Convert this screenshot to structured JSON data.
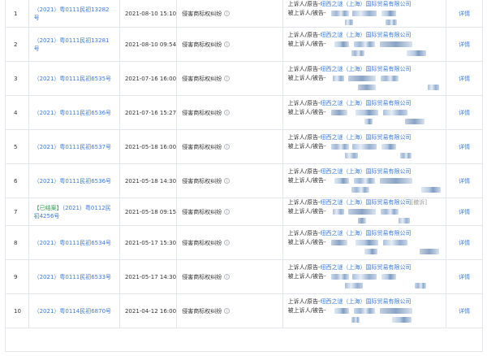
{
  "detail_label": "详情",
  "rows": [
    {
      "num": "1",
      "case": "（2021）粤0111民初13282号",
      "ended": "",
      "date": "2021-08-10 15:10",
      "cause": "侵害商标权纠纷",
      "p1_role": "上诉人/原告-",
      "p1_company": "纽西之谜（上海）国际贸易有限公司",
      "p1_extra": "",
      "p2_role": "被上诉人/被告-"
    },
    {
      "num": "2",
      "case": "（2021）粤0111民初13281号",
      "ended": "",
      "date": "2021-08-10 09:54",
      "cause": "侵害商标权纠纷",
      "p1_role": "上诉人/原告-",
      "p1_company": "纽西之谜（上海）国际贸易有限公司",
      "p1_extra": "",
      "p2_role": "被上诉人/被告-"
    },
    {
      "num": "3",
      "case": "（2021）粤0111民初6535号",
      "ended": "",
      "date": "2021-07-16 16:00",
      "cause": "侵害商标权纠纷",
      "p1_role": "上诉人/原告-",
      "p1_company": "纽西之谜（上海）国际贸易有限公司",
      "p1_extra": "",
      "p2_role": "被上诉人/被告-"
    },
    {
      "num": "4",
      "case": "（2021）粤0111民初6536号",
      "ended": "",
      "date": "2021-07-16 15:27",
      "cause": "侵害商标权纠纷",
      "p1_role": "上诉人/原告-",
      "p1_company": "纽西之谜（上海）国际贸易有限公司",
      "p1_extra": "",
      "p2_role": "被上诉人/被告-"
    },
    {
      "num": "5",
      "case": "（2021）粤0111民初6537号",
      "ended": "",
      "date": "2021-05-18 16:00",
      "cause": "侵害商标权纠纷",
      "p1_role": "上诉人/原告-",
      "p1_company": "纽西之谜（上海）国际贸易有限公司",
      "p1_extra": "",
      "p2_role": "被上诉人/被告-"
    },
    {
      "num": "6",
      "case": "（2021）粤0111民初6536号",
      "ended": "",
      "date": "2021-05-18 14:30",
      "cause": "侵害商标权纠纷",
      "p1_role": "上诉人/原告-",
      "p1_company": "纽西之谜（上海）国际贸易有限公司",
      "p1_extra": "",
      "p2_role": "被上诉人/被告-"
    },
    {
      "num": "7",
      "case": "（2021）粤0112民初4256号",
      "ended": "【已结案】",
      "date": "2021-05-18 09:15",
      "cause": "侵害商标权纠纷",
      "p1_role": "上诉人/原告-",
      "p1_company": "纽西之谜（上海）国际贸易有限公司",
      "p1_extra": "[撤诉]",
      "p2_role": "被上诉人/被告-"
    },
    {
      "num": "8",
      "case": "（2021）粤0111民初6534号",
      "ended": "",
      "date": "2021-05-17 15:30",
      "cause": "侵害商标权纠纷",
      "p1_role": "上诉人/原告-",
      "p1_company": "纽西之谜（上海）国际贸易有限公司",
      "p1_extra": "",
      "p2_role": "被上诉人/被告-"
    },
    {
      "num": "9",
      "case": "（2021）粤0111民初6533号",
      "ended": "",
      "date": "2021-05-17 14:30",
      "cause": "侵害商标权纠纷",
      "p1_role": "上诉人/原告-",
      "p1_company": "纽西之谜（上海）国际贸易有限公司",
      "p1_extra": "",
      "p2_role": "被上诉人/被告-"
    },
    {
      "num": "10",
      "case": "（2021）粤0114民初6870号",
      "ended": "",
      "date": "2021-04-12 16:00",
      "cause": "侵害商标权纠纷",
      "p1_role": "上诉人/原告-",
      "p1_company": "纽西之谜（上海）国际贸易有限公司",
      "p1_extra": "",
      "p2_role": "被上诉人/被告-"
    }
  ]
}
